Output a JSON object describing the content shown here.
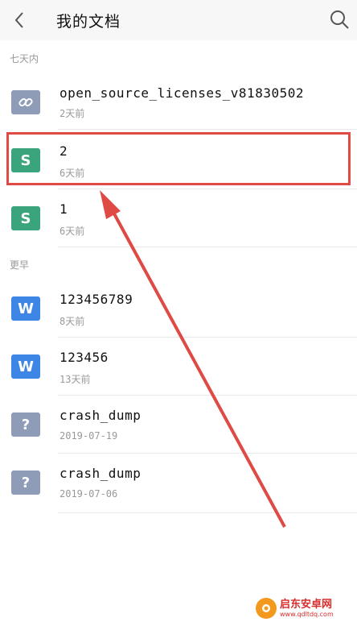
{
  "header": {
    "title": "我的文档"
  },
  "sections": [
    {
      "label": "七天内",
      "items": [
        {
          "name": "open_source_licenses_v81830502",
          "meta": "2天前",
          "icon": "link-icon",
          "icon_color": "#8f9cb8",
          "glyph": "🔗"
        },
        {
          "name": "2",
          "meta": "6天前",
          "icon": "sheet-icon",
          "icon_color": "#3aa57c",
          "glyph": "S"
        },
        {
          "name": "1",
          "meta": "6天前",
          "icon": "sheet-icon",
          "icon_color": "#3aa57c",
          "glyph": "S"
        }
      ]
    },
    {
      "label": "更早",
      "items": [
        {
          "name": "123456789",
          "meta": "8天前",
          "icon": "word-doc-icon",
          "icon_color": "#3e86e6",
          "glyph": "W"
        },
        {
          "name": "123456",
          "meta": "13天前",
          "icon": "word-doc-icon",
          "icon_color": "#3e86e6",
          "glyph": "W"
        },
        {
          "name": "crash_dump",
          "meta": "2019-07-19",
          "icon": "unknown-file-icon",
          "icon_color": "#8f9cb8",
          "glyph": "?"
        },
        {
          "name": "crash_dump",
          "meta": "2019-07-06",
          "icon": "unknown-file-icon",
          "icon_color": "#8f9cb8",
          "glyph": "?"
        }
      ]
    }
  ],
  "watermark": {
    "text": "启东安卓网",
    "url": "www.qdltdq.com"
  },
  "colors": {
    "highlight": "#e04a45",
    "arrow": "#e04a45"
  }
}
